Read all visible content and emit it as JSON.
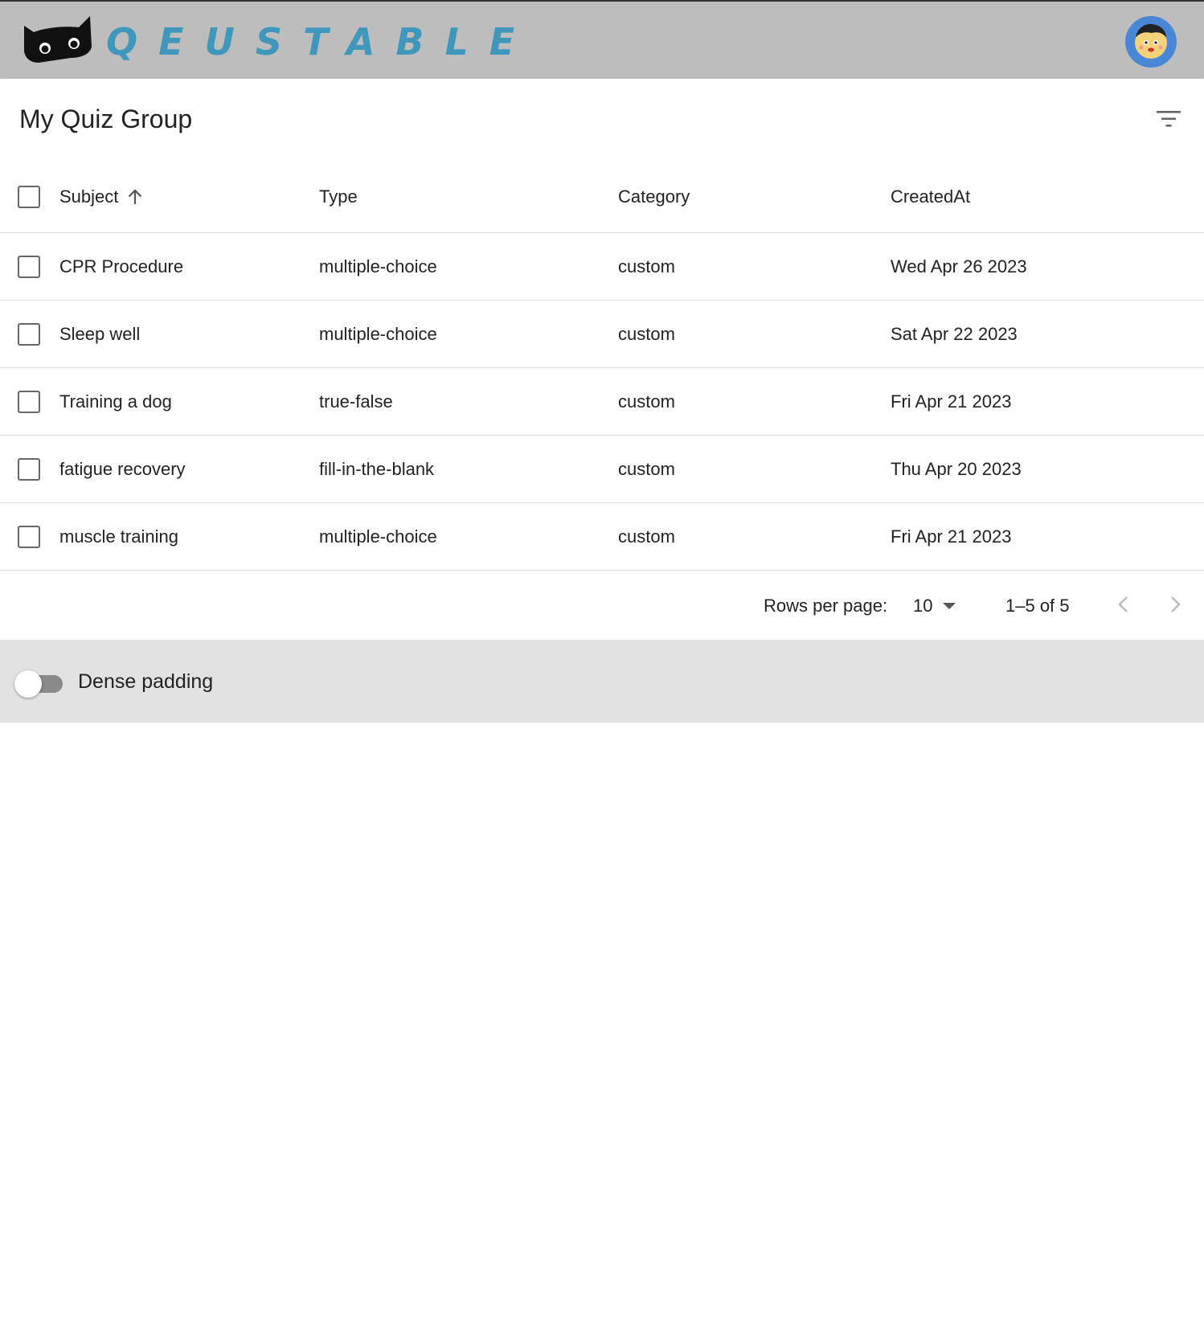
{
  "header": {
    "logo_text": "QEUSTABLE",
    "accent_color": "#3f97bb",
    "logo_icon": "cat-icon",
    "avatar_icon": "user-avatar-icon"
  },
  "table": {
    "title": "My Quiz Group",
    "filter_icon": "filter-list-icon",
    "columns": [
      "Subject",
      "Type",
      "Category",
      "CreatedAt"
    ],
    "sort": {
      "column": "Subject",
      "direction": "ascending"
    },
    "rows": [
      {
        "subject": "CPR Procedure",
        "type": "multiple-choice",
        "category": "custom",
        "created_at": "Wed Apr 26 2023",
        "checked": false
      },
      {
        "subject": "Sleep well",
        "type": "multiple-choice",
        "category": "custom",
        "created_at": "Sat Apr 22 2023",
        "checked": false
      },
      {
        "subject": "Training a dog",
        "type": "true-false",
        "category": "custom",
        "created_at": "Fri Apr 21 2023",
        "checked": false
      },
      {
        "subject": "fatigue recovery",
        "type": "fill-in-the-blank",
        "category": "custom",
        "created_at": "Thu Apr 20 2023",
        "checked": false
      },
      {
        "subject": "muscle training",
        "type": "multiple-choice",
        "category": "custom",
        "created_at": "Fri Apr 21 2023",
        "checked": false
      }
    ]
  },
  "pagination": {
    "rows_per_page_label": "Rows per page:",
    "rows_per_page_value": "10",
    "range_text": "1–5 of 5"
  },
  "footer": {
    "dense_label": "Dense padding",
    "dense_enabled": false
  }
}
